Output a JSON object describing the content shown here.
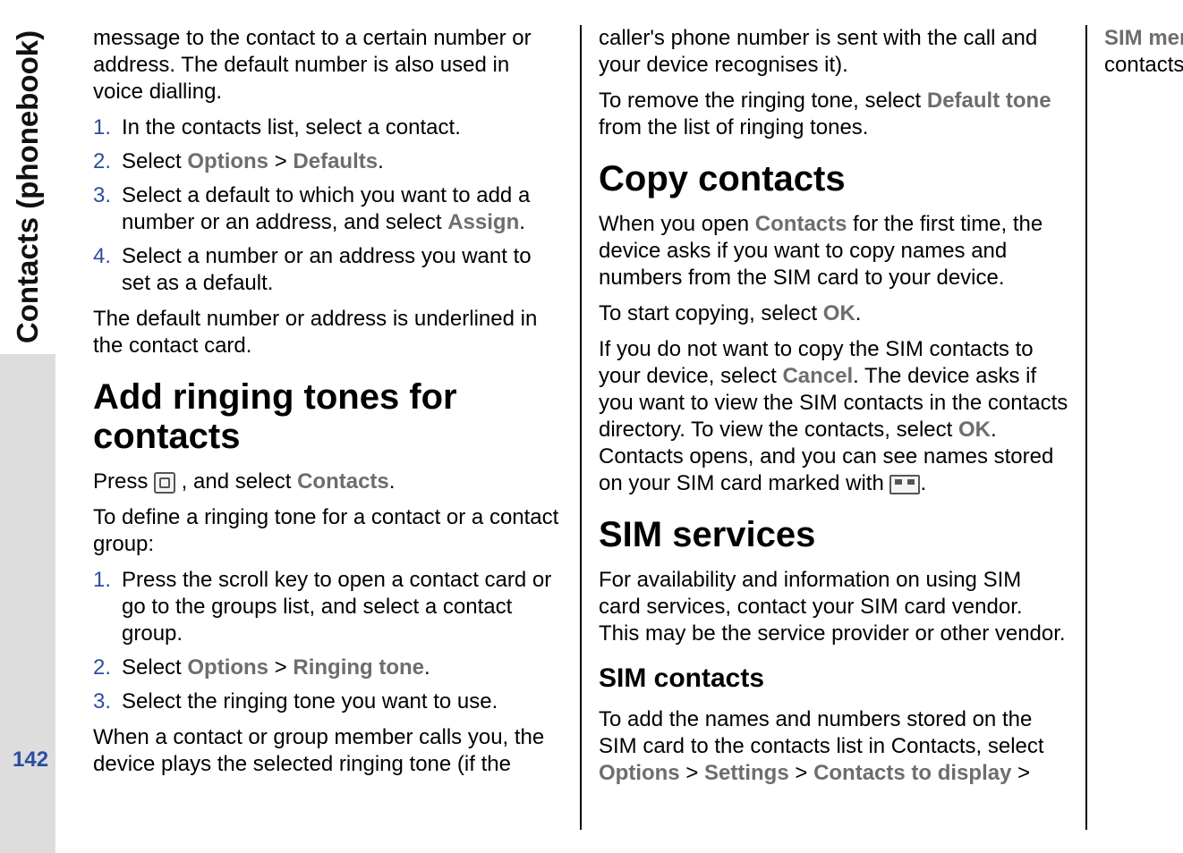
{
  "side": {
    "label": "Contacts (phonebook)",
    "page_number": "142"
  },
  "left_col": {
    "intro_para": "message to the contact to a certain number or address. The default number is also used in voice dialling.",
    "assign_list": {
      "n1": "1.",
      "t1": "In the contacts list, select a contact.",
      "n2": "2.",
      "t2a": "Select ",
      "t2b": "Options",
      "t2c": " > ",
      "t2d": "Defaults",
      "t2e": ".",
      "n3": "3.",
      "t3a": "Select a default to which you want to add a number or an address, and select ",
      "t3b": "Assign",
      "t3c": ".",
      "n4": "4.",
      "t4": "Select a number or an address you want to set as a default."
    },
    "underline_para": "The default number or address is underlined in the contact card.",
    "h2_ringtones": "Add ringing tones for contacts",
    "press_a": "Press ",
    "press_b": " , and select ",
    "press_c": "Contacts",
    "press_d": ".",
    "define_para": "To define a ringing tone for a contact or a contact group:",
    "ring_list": {
      "n1": "1.",
      "t1": "Press the scroll key to open a contact card or go to the groups list, and select a contact group.",
      "n2": "2.",
      "t2a": "Select ",
      "t2b": "Options",
      "t2c": " > ",
      "t2d": "Ringing tone",
      "t2e": ".",
      "n3": "3.",
      "t3": "Select the ringing tone you want to use."
    },
    "calls_para": "When a contact or group member calls you, the device plays the selected ringing tone (if the caller's phone number is sent with the call and your device recognises it)."
  },
  "right_col": {
    "remove_a": "To remove the ringing tone, select ",
    "remove_b": "Default tone",
    "remove_c": " from the list of ringing tones.",
    "h2_copy": "Copy contacts",
    "copy_open_a": "When you open ",
    "copy_open_b": "Contacts",
    "copy_open_c": " for the first time, the device asks if you want to copy names and numbers from the SIM card to your device.",
    "copy_start_a": "To start copying, select ",
    "copy_start_b": "OK",
    "copy_start_c": ".",
    "copy_cancel_a": "If you do not want to copy the SIM contacts to your device, select ",
    "copy_cancel_b": "Cancel",
    "copy_cancel_c": ". The device asks if you want to view the SIM contacts in the contacts directory. To view the contacts, select ",
    "copy_cancel_d": "OK",
    "copy_cancel_e": ". Contacts opens, and you can see names stored on your SIM card marked with ",
    "copy_cancel_f": ".",
    "h2_sim": "SIM services",
    "sim_avail": "For availability and information on using SIM card services, contact your SIM card vendor. This may be the service provider or other vendor.",
    "h3_simcontacts": "SIM contacts",
    "simc_a": "To add the names and numbers stored on the SIM card to the contacts list in Contacts, select ",
    "simc_b": "Options",
    "simc_c": " > ",
    "simc_d": "Settings",
    "simc_e": " > ",
    "simc_f": "Contacts to display",
    "simc_g": " > ",
    "simc_h": "SIM memory",
    "simc_i": ". You can add and edit SIM contacts, or call them."
  }
}
